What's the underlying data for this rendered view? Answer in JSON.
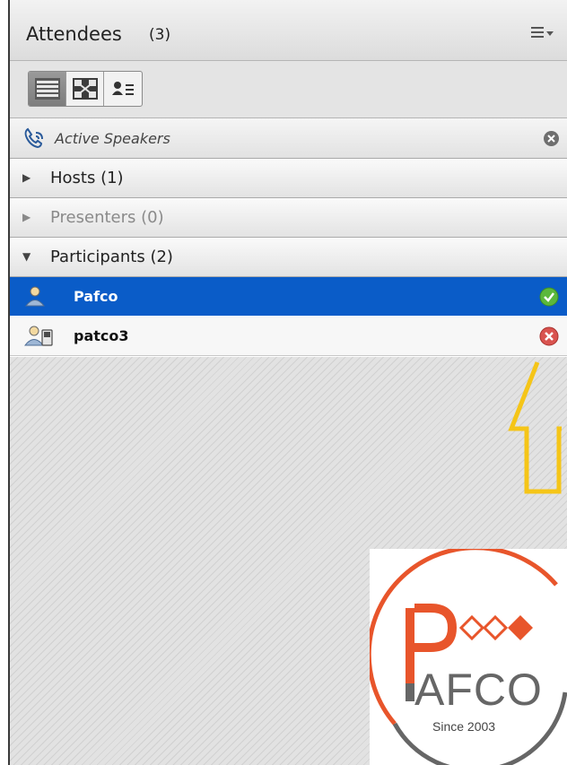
{
  "header": {
    "title": "Attendees",
    "count": "(3)",
    "menu_icon": "hamburger-menu-dropdown-icon"
  },
  "toolbar": {
    "views": [
      {
        "icon": "list-view-icon",
        "active": true
      },
      {
        "icon": "network-view-icon",
        "active": false
      },
      {
        "icon": "card-view-icon",
        "active": false
      }
    ]
  },
  "active_speakers": {
    "label": "Active Speakers",
    "icon": "phone-speaking-icon",
    "close_icon": "close-circle-icon"
  },
  "groups": [
    {
      "label": "Hosts (1)",
      "expanded": false,
      "dimmed": false
    },
    {
      "label": "Presenters (0)",
      "expanded": false,
      "dimmed": true
    },
    {
      "label": "Participants (2)",
      "expanded": true,
      "dimmed": false
    }
  ],
  "participants": [
    {
      "name": "Pafco",
      "selected": true,
      "status": "ready",
      "status_color": "#5cb83c",
      "icon": "user-icon"
    },
    {
      "name": "patco3",
      "selected": false,
      "status": "not-ready",
      "status_color": "#d9534f",
      "icon": "user-phone-icon"
    }
  ],
  "annotation": {
    "icon": "up-arrow-outline-icon",
    "color": "#f5c518"
  },
  "logo": {
    "brand_letters": "AFCO",
    "initial": "P",
    "tagline": "Since 2003",
    "brand_color": "#e8552b"
  },
  "colors": {
    "selection": "#0a5cc8",
    "panel_bg": "#e2e2e2"
  }
}
